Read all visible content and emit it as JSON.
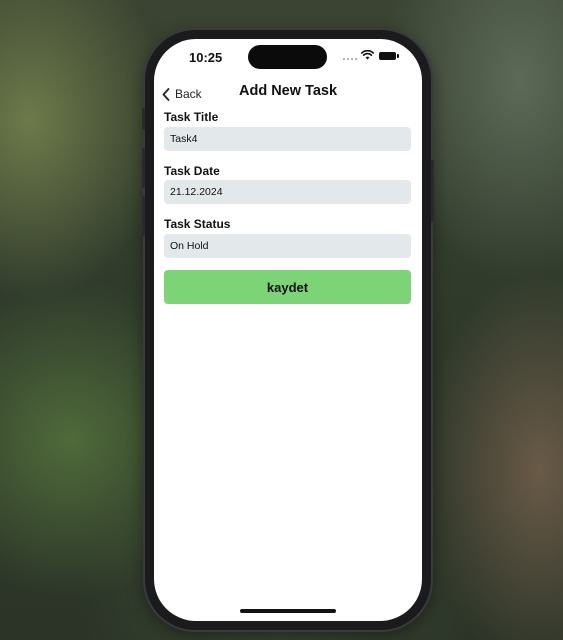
{
  "status_bar": {
    "time": "10:25"
  },
  "nav": {
    "back_label": "Back",
    "title": "Add New Task"
  },
  "form": {
    "fields": [
      {
        "label": "Task Title",
        "value": "Task4"
      },
      {
        "label": "Task Date",
        "value": "21.12.2024"
      },
      {
        "label": "Task Status",
        "value": "On Hold"
      }
    ],
    "save_label": "kaydet"
  },
  "colors": {
    "save_button": "#7dd476",
    "input_background": "#e3e8ea",
    "screen_background": "#ffffff"
  },
  "icons": [
    "chevron-left-icon",
    "signal-icon",
    "wifi-icon",
    "battery-icon"
  ]
}
